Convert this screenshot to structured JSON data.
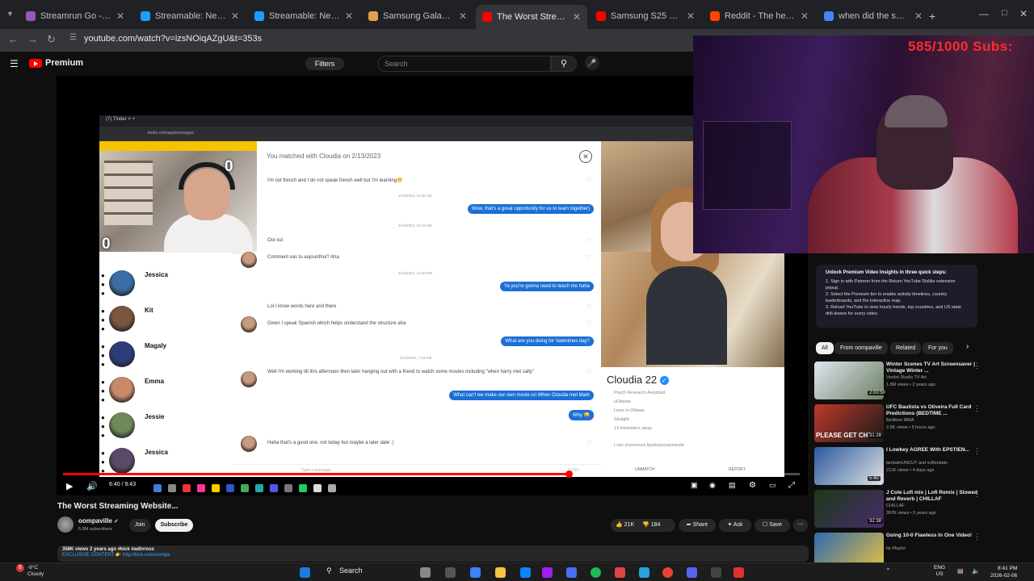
{
  "browser": {
    "tabs": [
      {
        "title": "Streamrun Go - Streamu",
        "color": "#9b59b6"
      },
      {
        "title": "Streamable: Never IRL Str",
        "color": "#1a9fff"
      },
      {
        "title": "Streamable: Never IRL Str",
        "color": "#1a9fff"
      },
      {
        "title": "Samsung Galaxy Fe S25 fr",
        "color": "#e0a04d"
      },
      {
        "title": "The Worst Streaming",
        "color": "#ff0000"
      },
      {
        "title": "Samsung S25 FE Camera",
        "color": "#ff0000"
      },
      {
        "title": "Reddit - The heart of the",
        "color": "#ff4500"
      },
      {
        "title": "when did the samsung s2",
        "color": "#4285f4"
      }
    ],
    "url": "youtube.com/watch?v=izsNOiqAZgU&t=353s"
  },
  "yt": {
    "logo": "Premium",
    "filters": "Filters",
    "search_placeholder": "Search"
  },
  "inner": {
    "matched": "You matched with Cloudia on 2/13/2023",
    "counter_a": "0",
    "counter_b": "0",
    "messages": [
      {
        "dir": "in",
        "text": "I'm not french and I do not speak french well but I'm learning😁"
      },
      {
        "dir": "ts",
        "text": "2/13/2023, 11:06 AM"
      },
      {
        "dir": "out",
        "text": "Wow, that's a great opportunity for us to learn together)"
      },
      {
        "dir": "ts",
        "text": "2/14/2023, 10:16 AM"
      },
      {
        "dir": "in",
        "text": "Oui oui"
      },
      {
        "dir": "in",
        "text": "Comment vas tu aujourdhui? Aha"
      },
      {
        "dir": "ts",
        "text": "2/14/2023, 12:46 PM"
      },
      {
        "dir": "out",
        "text": "Ya you're gonna need to teach me haha"
      },
      {
        "dir": "in",
        "text": "Lol I know words here and there"
      },
      {
        "dir": "in",
        "text": "Given I speak Spanish which helps understand the structure aha"
      },
      {
        "dir": "out",
        "text": "What are you doing for Valentines day?"
      },
      {
        "dir": "ts",
        "text": "2/14/2023, 7:16 PM"
      },
      {
        "dir": "in",
        "text": "Well I'm working till this afternoon then later hanging out with a friend to watch some movies including \"when harry met sally\""
      },
      {
        "dir": "out",
        "text": "What can't we make our own movie on When Cloudia met Mark"
      },
      {
        "dir": "out",
        "text": "Why 😜"
      },
      {
        "dir": "in",
        "text": "Haha that's a good one, not today but maybe a later date :)"
      }
    ],
    "list": [
      {
        "name": "Jessica",
        "color": "#3a6ea5"
      },
      {
        "name": "Kit",
        "color": "#7a5540"
      },
      {
        "name": "Magaly",
        "color": "#2c3e7a"
      },
      {
        "name": "Emma",
        "color": "#c98a6a"
      },
      {
        "name": "Jessie",
        "color": "#6e8a5a"
      },
      {
        "name": "Jessica",
        "color": "#5a4a6a"
      }
    ],
    "profile_name": "Cloudia 22",
    "profile_info": [
      "Psych Research Assistant",
      "uOttawa",
      "Lives in Ottawa",
      "Straight",
      "13 kilometers away"
    ],
    "profile_bio": "I can pronounce lipoboryssachande",
    "composer_placeholder": "Type a message",
    "send": "SEND",
    "unmatch": "UNMATCH",
    "report": "REPORT"
  },
  "player": {
    "time": "6:40 / 9:43",
    "progress": 0.686
  },
  "webcam": {
    "subs_text": "585/1000  Subs:"
  },
  "sidebar": {
    "premium_title": "Unlock Premium Video Insights in three quick steps:",
    "premium_steps": [
      "1. Sign in with Patreon from the Return YouTube Dislike extension popup.",
      "2. Select the Premium tier to enable activity timelines, country leaderboards, and the interactive map.",
      "3. Reload YouTube to view hourly trends, top countries, and US state drill-downs for every video."
    ],
    "chips": [
      "All",
      "From oompaville",
      "Related",
      "For you"
    ],
    "recs": [
      {
        "title": "Winter Scenes TV Art Screensaver | Vintage Winter ...",
        "channel": "Verdot Studio TV Art",
        "views": "1.8M views • 2 years ago",
        "dur": "2:00:50",
        "c1": "#dfe6ee",
        "c2": "#6d7f63"
      },
      {
        "title": "UFC Bautista vs Oliveira Full Card Predictions (BEDTIME ...",
        "channel": "Bedtime MMA",
        "views": "2.5K views • 5 hours ago",
        "dur": "31:28",
        "c1": "#c0392b",
        "c2": "#1a1a1a",
        "overlay": "PLEASE GET CHI"
      },
      {
        "title": "I Lowkey AGREE With EPSTIEN...",
        "channel": "benlatinUNCUT and scBenlatin",
        "views": "211K views • 4 days ago",
        "dur": "5:40",
        "c1": "#2a5aa0",
        "c2": "#e0e0e0"
      },
      {
        "title": "J Cole Lofi mix | Lofi Remix | Slowed and Reverb | CHILLAF",
        "channel": "CHILLAF",
        "views": "397K views • 5 years ago",
        "dur": "32:38",
        "c1": "#1a3a1a",
        "c2": "#4a2a6a"
      },
      {
        "title": "Going 10-0 Flawless In One Video!",
        "channel": "Its Playful",
        "views": "",
        "dur": "",
        "c1": "#2d6ab0",
        "c2": "#e8c040"
      }
    ]
  },
  "video": {
    "title": "The Worst Streaming Website...",
    "channel": "oompaville",
    "subs": "5.9M subscribers",
    "join": "Join",
    "subscribe": "Subscribe",
    "likes": "21K",
    "dislikes": "184",
    "share": "Share",
    "ask": "Ask",
    "save": "Save",
    "desc_line1": "358K views  2 years ago  #kick #adinross",
    "desc_line2": "EXCLUSIVE CONTENT 👉 http://kick.com/oompa"
  },
  "taskbar": {
    "temp": "-9°C",
    "cond": "Cloudy",
    "search": "Search",
    "lang1": "ENG",
    "lang2": "US",
    "time": "8:41 PM",
    "date": "2026-02-06"
  }
}
